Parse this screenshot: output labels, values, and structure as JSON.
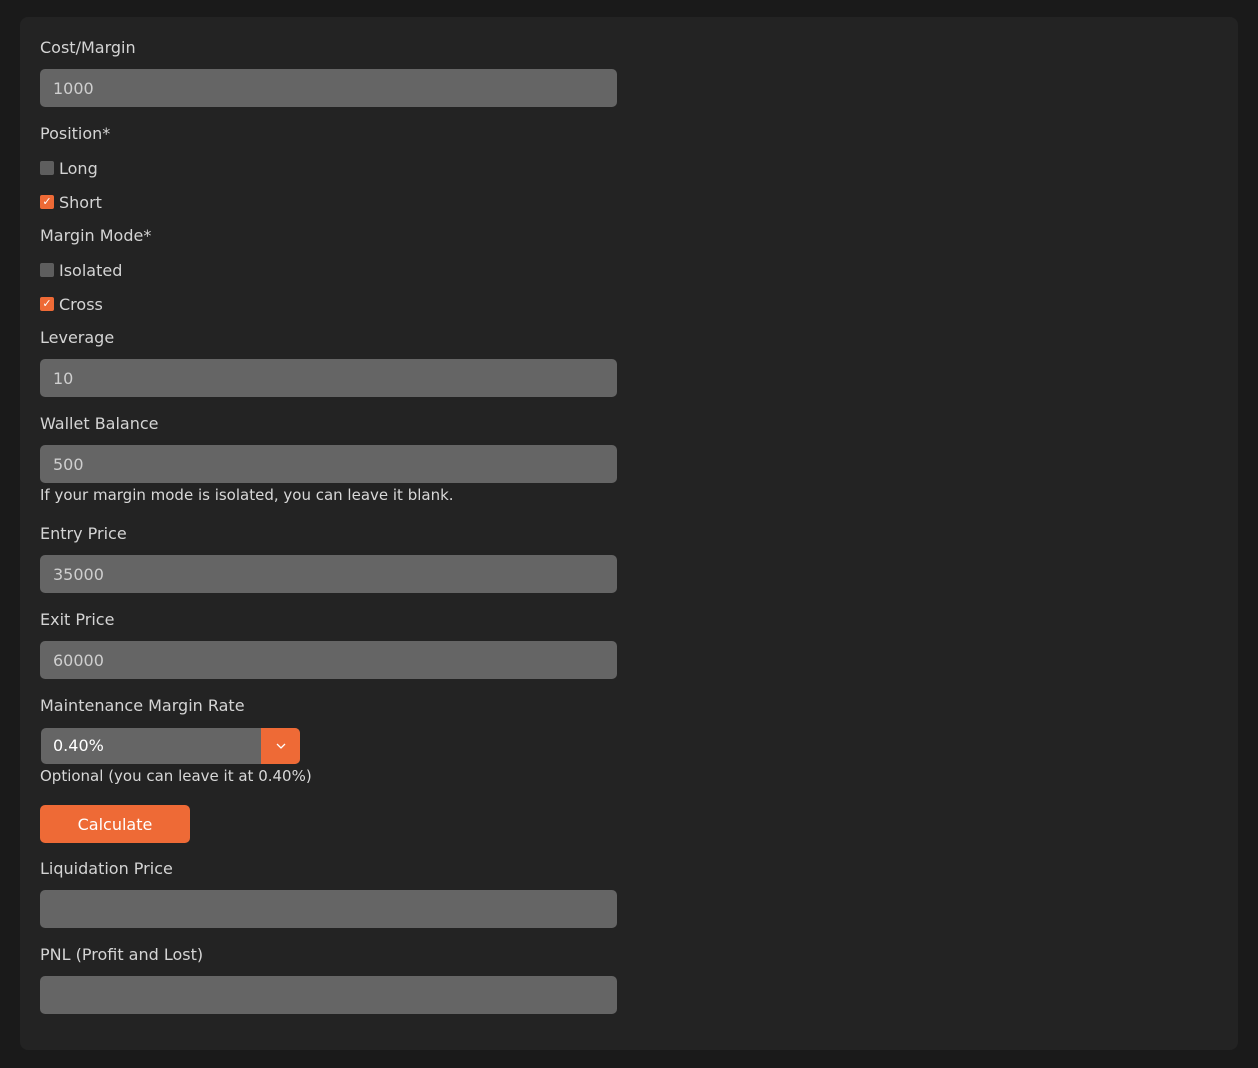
{
  "form": {
    "cost_margin": {
      "label": "Cost/Margin",
      "value": "1000"
    },
    "position": {
      "label": "Position*",
      "options": [
        {
          "label": "Long",
          "checked": false
        },
        {
          "label": "Short",
          "checked": true
        }
      ]
    },
    "margin_mode": {
      "label": "Margin Mode*",
      "options": [
        {
          "label": "Isolated",
          "checked": false
        },
        {
          "label": "Cross",
          "checked": true
        }
      ]
    },
    "leverage": {
      "label": "Leverage",
      "value": "10"
    },
    "wallet_balance": {
      "label": "Wallet Balance",
      "value": "500",
      "hint": "If your margin mode is isolated, you can leave it blank."
    },
    "entry_price": {
      "label": "Entry Price",
      "value": "35000"
    },
    "exit_price": {
      "label": "Exit Price",
      "value": "60000"
    },
    "maintenance_margin_rate": {
      "label": "Maintenance Margin Rate",
      "selected": "0.40%",
      "hint": "Optional (you can leave it at 0.40%)"
    },
    "calculate_label": "Calculate",
    "liquidation_price": {
      "label": "Liquidation Price",
      "value": ""
    },
    "pnl": {
      "label": "PNL (Profit and Lost)",
      "value": ""
    }
  },
  "colors": {
    "page_bg": "#1a1a1a",
    "panel_bg": "#232323",
    "field_bg": "#656565",
    "accent": "#ee6a36",
    "text": "#d4d4d4"
  },
  "icons": {
    "checkbox_checked": "checkmark-icon",
    "select_arrow": "chevron-down-icon"
  }
}
